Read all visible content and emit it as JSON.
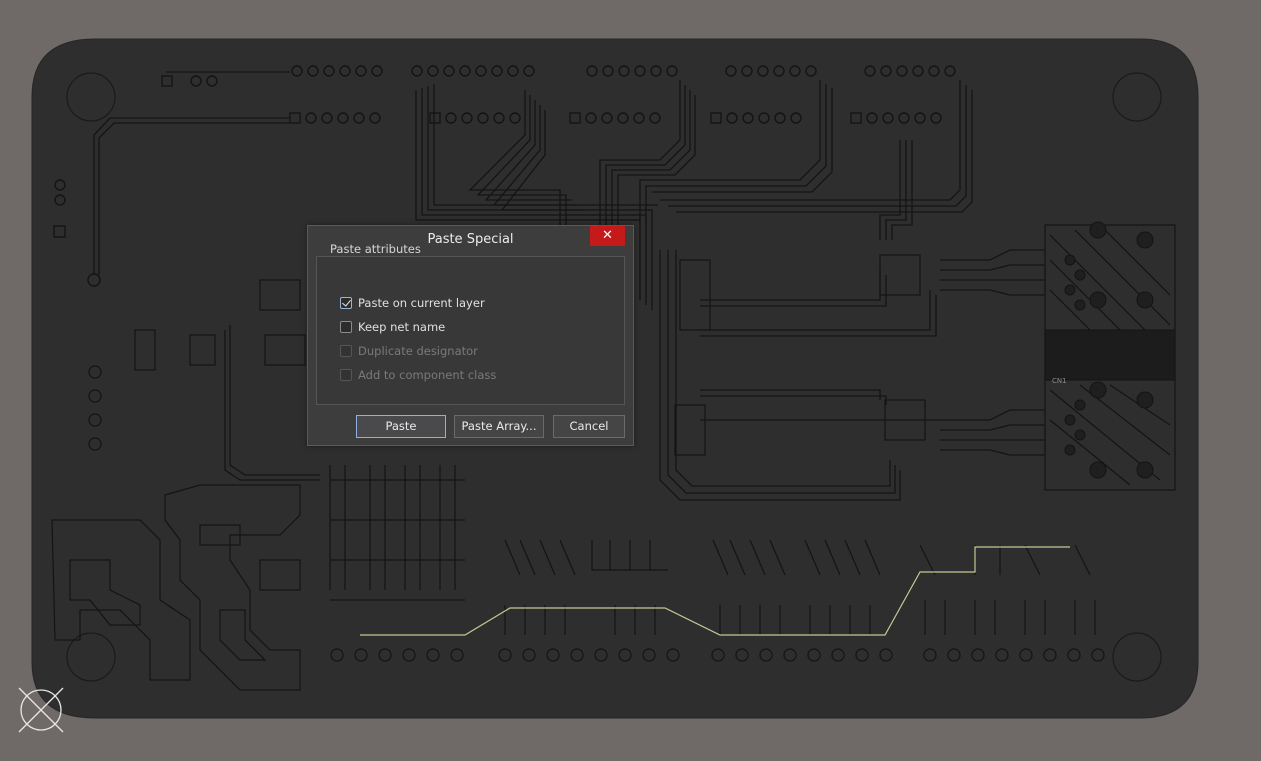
{
  "dialog": {
    "title": "Paste Special",
    "close_label": "✕",
    "group_title": "Paste attributes",
    "options": [
      {
        "label": "Paste on current layer",
        "checked": true,
        "enabled": true
      },
      {
        "label": "Keep net name",
        "checked": false,
        "enabled": true
      },
      {
        "label": "Duplicate designator",
        "checked": false,
        "enabled": false
      },
      {
        "label": "Add to component class",
        "checked": false,
        "enabled": false
      }
    ],
    "buttons": {
      "paste": "Paste",
      "paste_array": "Paste Array...",
      "cancel": "Cancel"
    }
  },
  "board": {
    "silkscreen_label": "CN1"
  },
  "colors": {
    "workspace": "#6f6a68",
    "board": "#2e2e2e",
    "trace": "#141414",
    "highlight_net": "#c8c896",
    "close_button": "#c41a1a"
  },
  "icons": {
    "close": "close-icon",
    "checkmark": "checkmark-icon",
    "origin_marker": "crosshair-circle-icon"
  }
}
